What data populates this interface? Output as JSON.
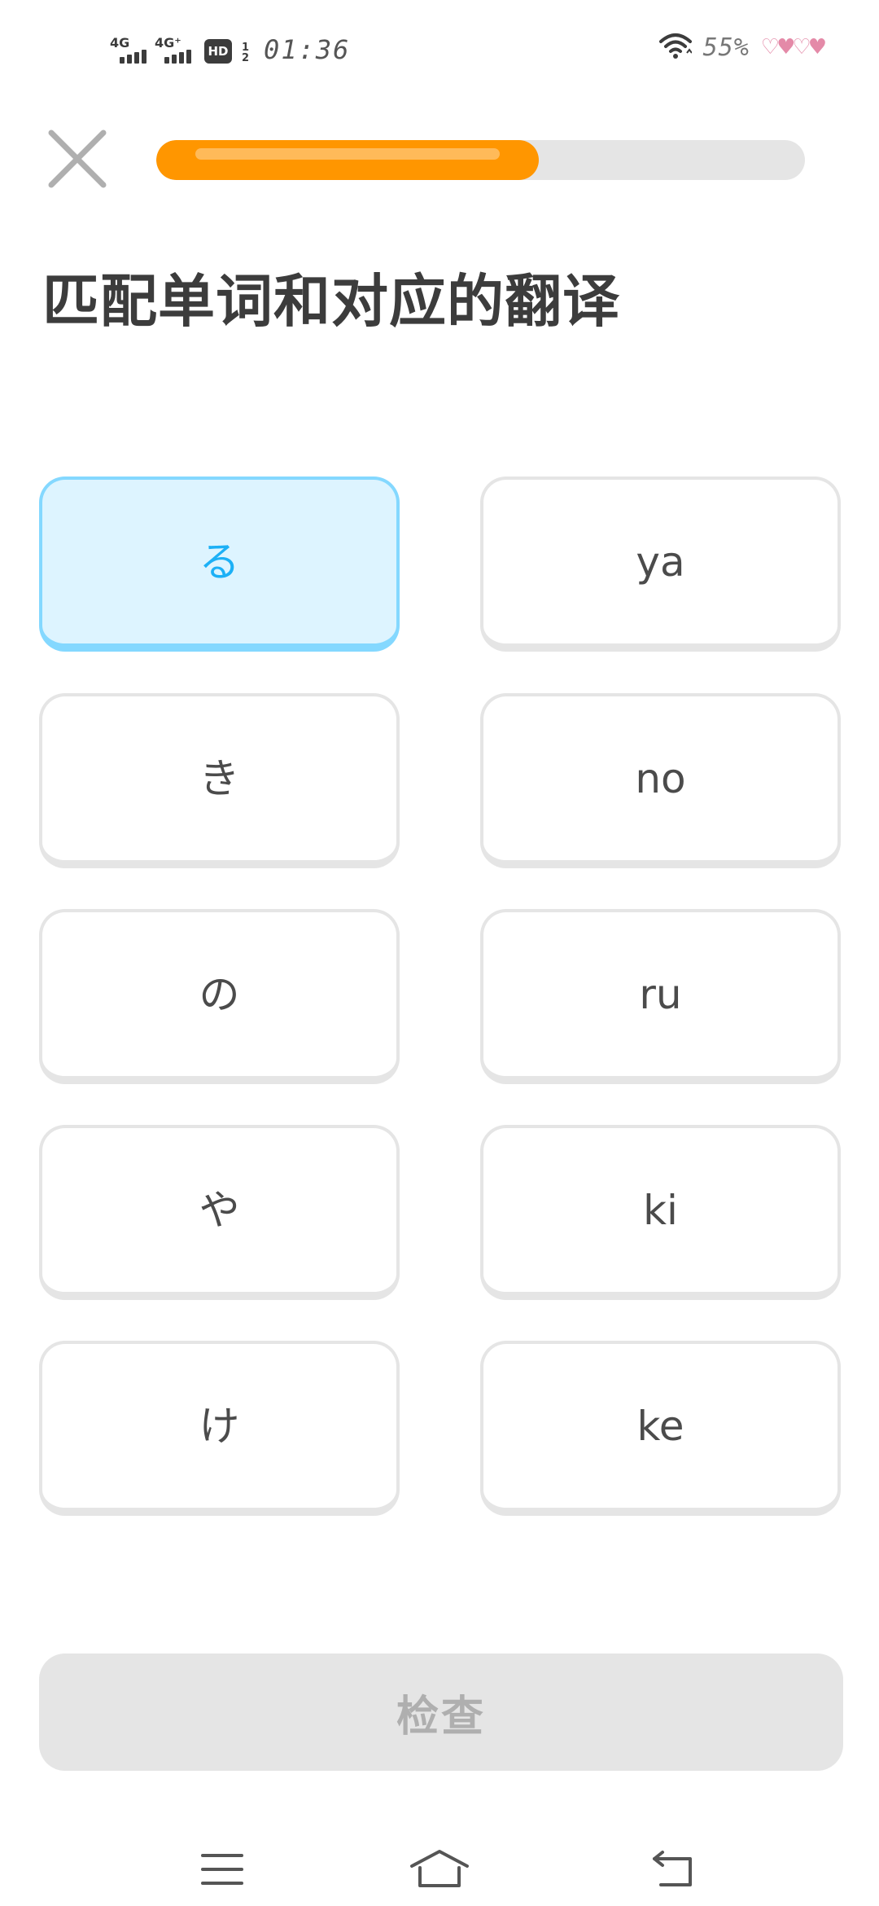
{
  "status_bar": {
    "network_1": "4G",
    "network_2": "4G⁺",
    "hd_label": "HD",
    "hd_sub_top": "1",
    "hd_sub_bottom": "2",
    "time": "01:36",
    "battery": "55%",
    "decoration_hearts": "♡♥♡♥",
    "icons": [
      "signal-icon",
      "signal-icon",
      "hd-icon",
      "wifi-icon",
      "hearts-icon"
    ]
  },
  "header": {
    "close_icon": "close-icon",
    "progress_fraction": 0.59,
    "progress_color": "#ff9600"
  },
  "exercise": {
    "title": "匹配单词和对应的翻译",
    "left_column": [
      {
        "label": "る",
        "selected": true
      },
      {
        "label": "き",
        "selected": false
      },
      {
        "label": "の",
        "selected": false
      },
      {
        "label": "や",
        "selected": false
      },
      {
        "label": "け",
        "selected": false
      }
    ],
    "right_column": [
      {
        "label": "ya",
        "selected": false
      },
      {
        "label": "no",
        "selected": false
      },
      {
        "label": "ru",
        "selected": false
      },
      {
        "label": "ki",
        "selected": false
      },
      {
        "label": "ke",
        "selected": false
      }
    ],
    "selected_color": "#1cb0f6"
  },
  "footer": {
    "check_label": "检查"
  },
  "nav_bar": {
    "icons": [
      "menu-icon",
      "home-icon",
      "back-icon"
    ]
  }
}
